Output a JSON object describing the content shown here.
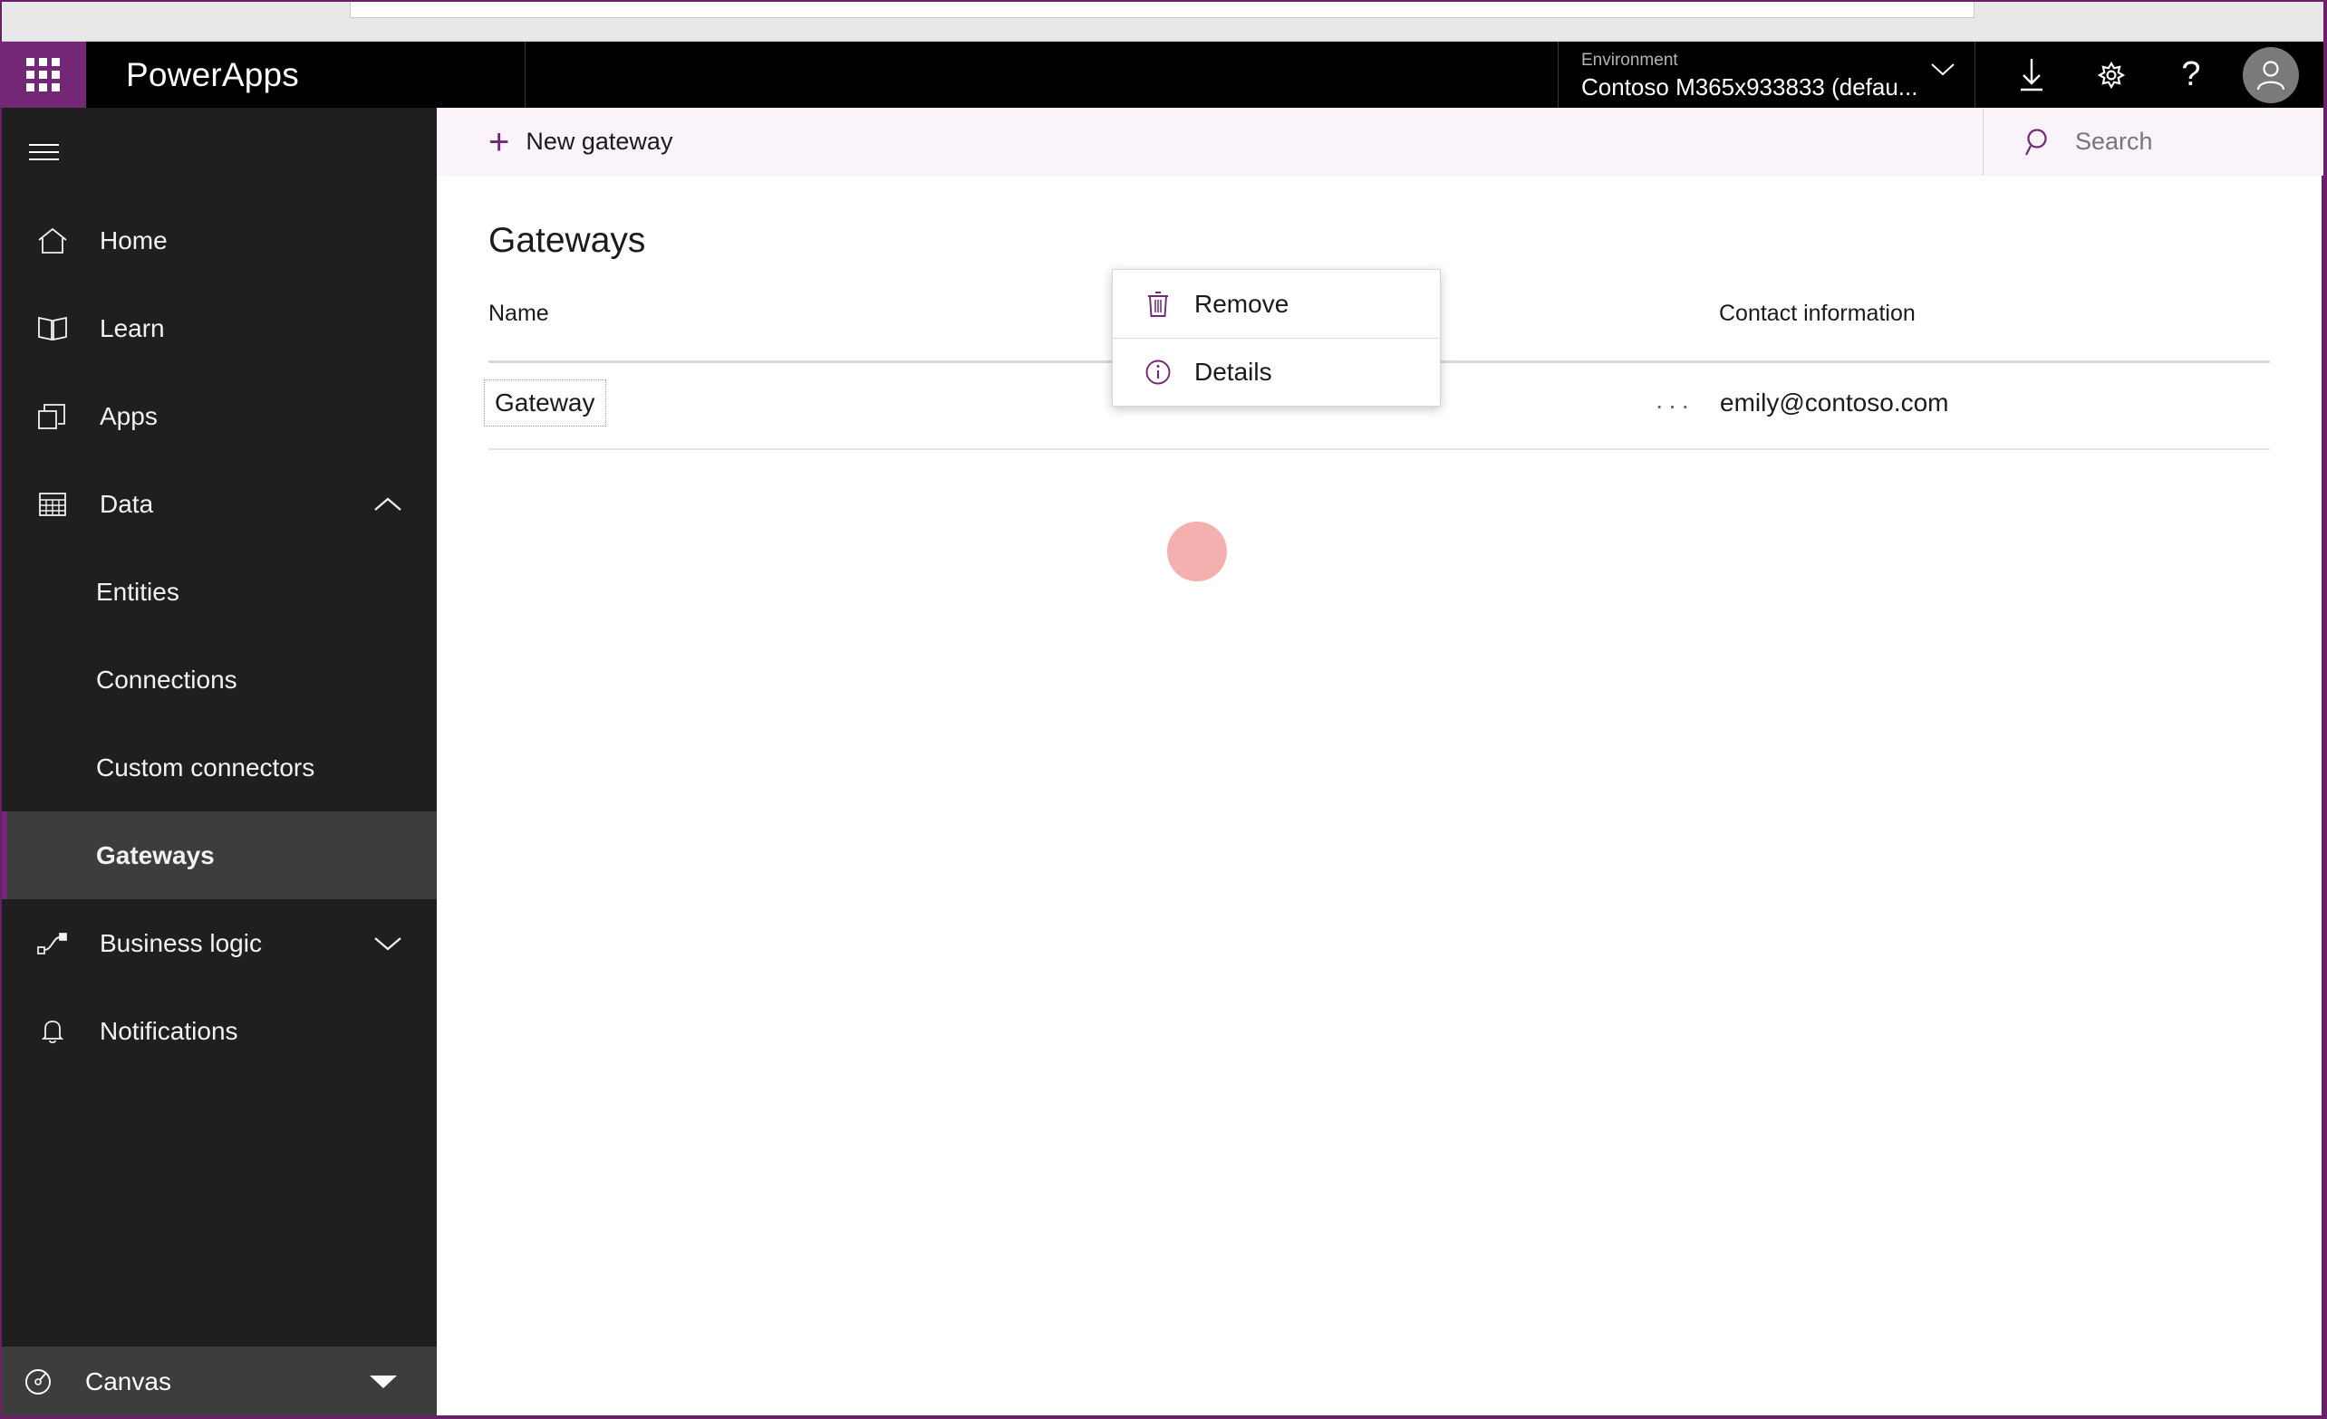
{
  "browser": {
    "chrome_strip": "",
    "address_bar": ""
  },
  "topbar": {
    "waffle_icon": "app-launcher-icon",
    "brand": "PowerApps",
    "environment": {
      "label": "Environment",
      "value": "Contoso M365x933833 (defau...",
      "chevron_icon": "chevron-down-icon"
    },
    "icons": [
      {
        "name": "download-icon",
        "label": "Download"
      },
      {
        "name": "gear-icon",
        "label": "Settings"
      },
      {
        "name": "help-icon",
        "label": "Help"
      },
      {
        "name": "avatar-icon",
        "label": "Account"
      }
    ]
  },
  "sidebar": {
    "hamburger_icon": "hamburger-menu-icon",
    "items": [
      {
        "label": "Home",
        "icon": "home-icon",
        "type": "item",
        "expand": null
      },
      {
        "label": "Learn",
        "icon": "book-icon",
        "type": "item",
        "expand": null
      },
      {
        "label": "Apps",
        "icon": "apps-icon",
        "type": "item",
        "expand": null
      },
      {
        "label": "Data",
        "icon": "table-icon",
        "type": "item",
        "expand": "chevron-up-icon"
      },
      {
        "label": "Entities",
        "icon": null,
        "type": "sub",
        "expand": null
      },
      {
        "label": "Connections",
        "icon": null,
        "type": "sub",
        "expand": null
      },
      {
        "label": "Custom connectors",
        "icon": null,
        "type": "sub",
        "expand": null
      },
      {
        "label": "Gateways",
        "icon": null,
        "type": "sub",
        "expand": null,
        "selected": true
      },
      {
        "label": "Business logic",
        "icon": "flow-icon",
        "type": "item",
        "expand": "chevron-down-icon"
      },
      {
        "label": "Notifications",
        "icon": "bell-icon",
        "type": "item",
        "expand": null
      }
    ],
    "footer": {
      "label": "Canvas",
      "icon": "gauge-icon",
      "chevron_icon": "caret-down-icon"
    },
    "accent_color": "#742774",
    "selected_bg": "#3d3d3d"
  },
  "commandbar": {
    "new_gateway": {
      "label": "New gateway",
      "icon": "plus-icon"
    },
    "search": {
      "placeholder": "Search",
      "icon": "search-icon"
    },
    "background": "#faf3fa"
  },
  "main": {
    "title": "Gateways",
    "table": {
      "columns": [
        "Name",
        "Contact information"
      ],
      "rows": [
        {
          "name": "Gateway",
          "contact": "emily@contoso.com",
          "overflow_icon": "ellipsis-icon"
        }
      ]
    }
  },
  "context_menu": {
    "items": [
      {
        "label": "Remove",
        "icon": "trash-icon"
      },
      {
        "label": "Details",
        "icon": "info-icon"
      }
    ],
    "icon_color": "#742774"
  },
  "click_marker": {
    "color": "#eb6e6e",
    "target": "Details"
  },
  "colors": {
    "brand_purple": "#742774",
    "border_purple": "#6b1f68",
    "topbar_black": "#000000",
    "sidebar_dark": "#1f1f1f",
    "command_pink": "#faf3fa"
  }
}
